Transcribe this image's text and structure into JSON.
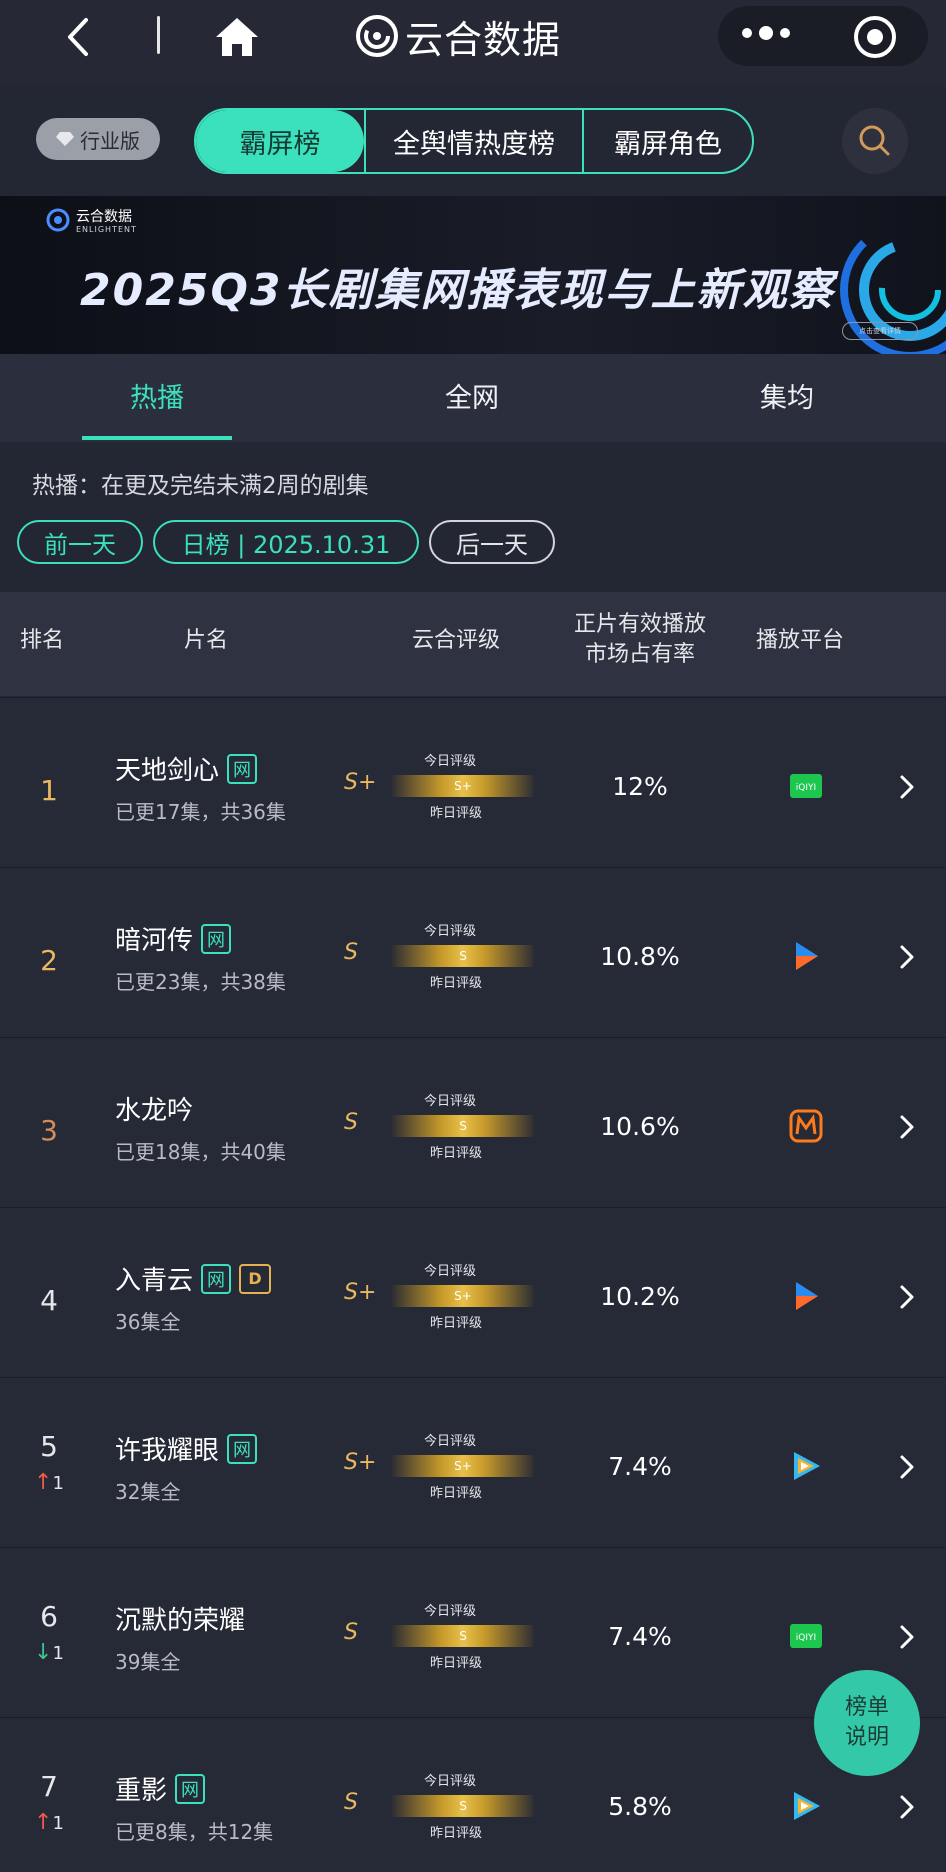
{
  "header": {
    "app_title": "云合数据",
    "icons": [
      "back-icon",
      "home-icon",
      "more-icon",
      "close-icon"
    ]
  },
  "edition": "行业版",
  "segment": {
    "items": [
      "霸屏榜",
      "全舆情热度榜",
      "霸屏角色"
    ],
    "active_index": 0
  },
  "banner": {
    "logo_text": "云合数据",
    "logo_sub": "ENLIGHTENT",
    "title": "2025Q3长剧集网播表现与上新观察",
    "cta": "点击查看详情"
  },
  "tabs": {
    "items": [
      "热播",
      "全网",
      "集均"
    ],
    "active_index": 0
  },
  "info": "热播：在更及完结未满2周的剧集",
  "date_nav": {
    "prev": "前一天",
    "current": "日榜 | 2025.10.31",
    "next": "后一天"
  },
  "table": {
    "headers": {
      "rank": "排名",
      "title": "片名",
      "grade": "云合评级",
      "share": "正片有效播放\n市场占有率",
      "platform": "播放平台"
    },
    "grade_today_label": "今日评级",
    "grade_yesterday_label": "昨日评级",
    "rows": [
      {
        "rank": "1",
        "delta": "",
        "delta_dir": "",
        "title": "天地剑心",
        "wang": "网",
        "extra_tag": "",
        "episodes": "已更17集，共36集",
        "grade": "S+",
        "grade_bar": "S+",
        "share": "12%",
        "platform": "iqiyi-icon"
      },
      {
        "rank": "2",
        "delta": "",
        "delta_dir": "",
        "title": "暗河传",
        "wang": "网",
        "extra_tag": "",
        "episodes": "已更23集，共38集",
        "grade": "S",
        "grade_bar": "S",
        "share": "10.8%",
        "platform": "youku-icon"
      },
      {
        "rank": "3",
        "delta": "",
        "delta_dir": "",
        "title": "水龙吟",
        "wang": "",
        "extra_tag": "",
        "episodes": "已更18集，共40集",
        "grade": "S",
        "grade_bar": "S",
        "share": "10.6%",
        "platform": "mango-tv-icon"
      },
      {
        "rank": "4",
        "delta": "",
        "delta_dir": "",
        "title": "入青云",
        "wang": "网",
        "extra_tag": "D",
        "episodes": "36集全",
        "grade": "S+",
        "grade_bar": "S+",
        "share": "10.2%",
        "platform": "youku-icon"
      },
      {
        "rank": "5",
        "delta": "1",
        "delta_dir": "up",
        "title": "许我耀眼",
        "wang": "网",
        "extra_tag": "",
        "episodes": "32集全",
        "grade": "S+",
        "grade_bar": "S+",
        "share": "7.4%",
        "platform": "tencent-video-icon"
      },
      {
        "rank": "6",
        "delta": "1",
        "delta_dir": "down",
        "title": "沉默的荣耀",
        "wang": "",
        "extra_tag": "",
        "episodes": "39集全",
        "grade": "S",
        "grade_bar": "S",
        "share": "7.4%",
        "platform": "iqiyi-icon"
      },
      {
        "rank": "7",
        "delta": "1",
        "delta_dir": "up",
        "title": "重影",
        "wang": "网",
        "extra_tag": "",
        "episodes": "已更8集，共12集",
        "grade": "S",
        "grade_bar": "S",
        "share": "5.8%",
        "platform": "tencent-video-icon"
      }
    ]
  },
  "help_fab": [
    "榜单",
    "说明"
  ],
  "colors": {
    "accent": "#3be0bd",
    "gold": "#e9b860",
    "background": "#232633"
  }
}
